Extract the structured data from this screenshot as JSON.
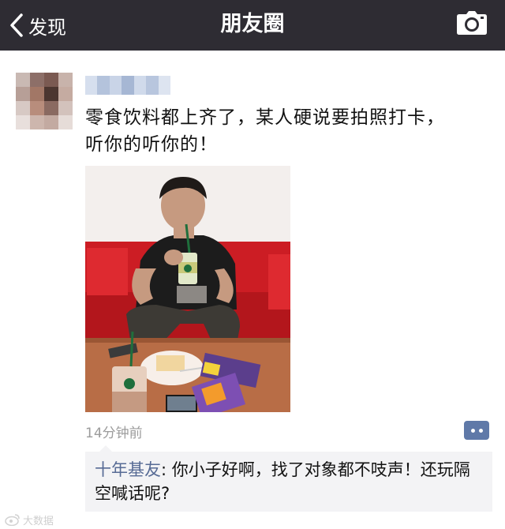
{
  "navbar": {
    "back_label": "发现",
    "title": "朋友圈",
    "back_icon": "chevron-left-icon",
    "camera_icon": "camera-icon"
  },
  "post": {
    "text": "零食饮料都上齐了，某人硬说要拍照打卡，听你的听你的！",
    "time": "14分钟前",
    "comment_icon": "comment-dots-icon"
  },
  "comment": {
    "author": "十年基友",
    "separator": ": ",
    "text": "你小子好啊，找了对象都不吱声！还玩隔空喊话呢?"
  },
  "watermark": {
    "text": "大数据"
  },
  "colors": {
    "navbar_bg": "#2e2c33",
    "link_blue": "#576b95",
    "comment_button": "#5f79a8",
    "comment_bg": "#f3f3f5"
  }
}
